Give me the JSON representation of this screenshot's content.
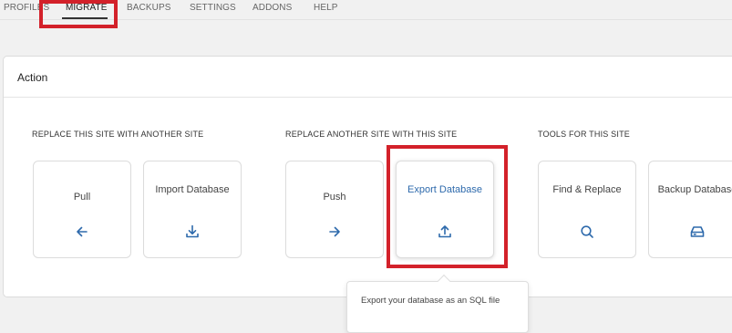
{
  "nav": {
    "tabs": [
      {
        "label": "PROFILES",
        "active": false
      },
      {
        "label": "MIGRATE",
        "active": true
      },
      {
        "label": "BACKUPS",
        "active": false
      },
      {
        "label": "SETTINGS",
        "active": false
      },
      {
        "label": "ADDONS",
        "active": false
      },
      {
        "label": "HELP",
        "active": false
      }
    ]
  },
  "panel": {
    "title": "Action",
    "sections": [
      {
        "label": "REPLACE THIS SITE WITH ANOTHER SITE",
        "cards": [
          {
            "label": "Pull",
            "icon": "arrow-left-icon"
          },
          {
            "label": "Import Database",
            "icon": "download-icon"
          }
        ]
      },
      {
        "label": "REPLACE ANOTHER SITE WITH THIS SITE",
        "cards": [
          {
            "label": "Push",
            "icon": "arrow-right-icon"
          },
          {
            "label": "Export Database",
            "icon": "upload-icon",
            "selected": true
          }
        ]
      },
      {
        "label": "TOOLS FOR THIS SITE",
        "cards": [
          {
            "label": "Find & Replace",
            "icon": "search-icon"
          },
          {
            "label": "Backup Database",
            "icon": "hard-drive-icon"
          }
        ]
      }
    ]
  },
  "tooltip": {
    "text": "Export your database as an SQL file"
  },
  "colors": {
    "accent": "#2e6aac",
    "highlight": "#d3212a",
    "background": "#f1f1f1"
  }
}
